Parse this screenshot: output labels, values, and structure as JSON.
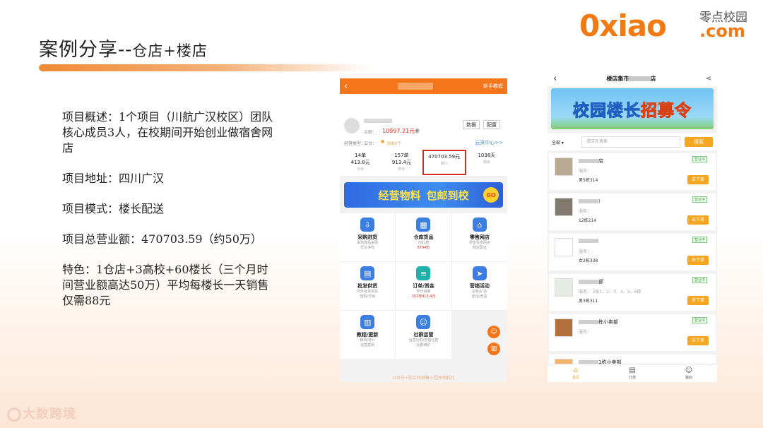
{
  "slide": {
    "title_main": "案例分享--",
    "title_sub": "仓店+楼店",
    "brand_main": "0xiao",
    "brand_cn": "零点校园",
    "brand_com": ".com",
    "watermark": "大数跨境",
    "paragraphs": [
      "项目概述：1个项目（川航广汉校区）团队核心成员3人，在校期间开始创业做宿舍网店",
      "项目地址：四川广汉",
      "项目模式：楼长配送",
      "项目总营业额：470703.59（约50万）",
      "特色：1仓店+3高校+60楼长（三个月时间营业额高达50万）平均每楼长一天销售仅需88元"
    ]
  },
  "phone1": {
    "header_right": "新手教程",
    "balance_label": "余额：",
    "balance": "10997.21元",
    "btn_data": "数据",
    "btn_config": "配置",
    "row2_left": "经营类型：",
    "row2_cloud": "云台：",
    "row2_coins": "3880个",
    "cloud_center": "云货中心>>",
    "stats": [
      {
        "main": "14单",
        "sub": "413.8元",
        "label": "今日"
      },
      {
        "main": "157单",
        "sub": "913.4元",
        "label": "昨日"
      },
      {
        "main": "470703.59元",
        "sub": "",
        "label": "累计"
      },
      {
        "main": "1036天",
        "sub": "",
        "label": "剩余"
      }
    ],
    "banner_left": "经营物料",
    "banner_right": "包邮到校",
    "banner_go": "GO",
    "menu": [
      {
        "name": "采购进货",
        "desc1": "采购食品采购",
        "desc2": "优价多样",
        "color": "#3b7de0",
        "icon": "⇩"
      },
      {
        "name": "仓库货品",
        "desc1": "7货1样",
        "desc2": "8794份",
        "color": "#3b7de0",
        "icon": "▦"
      },
      {
        "name": "零售网店",
        "desc1": "零售零食网店",
        "desc2": "网店配送",
        "color": "#3b7de0",
        "icon": "⌂"
      },
      {
        "name": "批发供货",
        "desc1": "对外批发供货",
        "desc2": "团购/分销",
        "color": "#3b7de0",
        "icon": "▤"
      },
      {
        "name": "订单/资金",
        "desc1": "昨日销量",
        "desc2": "157单913.4元",
        "color": "#20b2aa",
        "icon": "≡"
      },
      {
        "name": "营销活动",
        "desc1": "拉新/扩店",
        "desc2": "团活/盲盒",
        "color": "#3b7de0",
        "icon": "➤"
      },
      {
        "name": "教程/更新",
        "desc1": "精商/排行",
        "desc2": "运营案例",
        "color": "#3b7de0",
        "icon": "▥"
      },
      {
        "name": "社群运营",
        "desc1": "运营社群/管理社群",
        "desc2": "社群维护",
        "color": "#3b7de0",
        "icon": "☺"
      }
    ],
    "bottom_text": "公众号+购买校销售小程序物料打"
  },
  "phone2": {
    "title_prefix": "楼店集市",
    "title_suffix": "店",
    "banner_left": "校园楼长",
    "banner_right": "招募令",
    "select_label": "全部",
    "search_placeholder": "请店名搜索",
    "search_btn": "搜索",
    "stores": [
      {
        "name": "店",
        "sub": "服务：",
        "addr": "男5栋314",
        "status": "营业中",
        "go": "去下单"
      },
      {
        "name": "）",
        "sub": "服务：",
        "addr": "12栋214",
        "status": "营业中",
        "go": "去下单"
      },
      {
        "name": "",
        "sub": "服务：",
        "addr": "女2栋338",
        "status": "营业中",
        "go": "去下单"
      },
      {
        "name": "部",
        "sub": "服务： 3栋1、2、3、4、5、6楼",
        "addr": "男3栋311",
        "status": "营业中",
        "go": "去下单"
      },
      {
        "name": "栋小卖部",
        "sub": "服务：",
        "addr": "",
        "status": "营业中",
        "go": "去下单"
      },
      {
        "name": "1栋小卖部",
        "sub": "",
        "addr": "",
        "status": "",
        "go": ""
      }
    ],
    "tabs": [
      {
        "label": "首页",
        "icon": "⌂"
      },
      {
        "label": "订单",
        "icon": "▤"
      },
      {
        "label": "我的",
        "icon": "☺"
      }
    ]
  }
}
